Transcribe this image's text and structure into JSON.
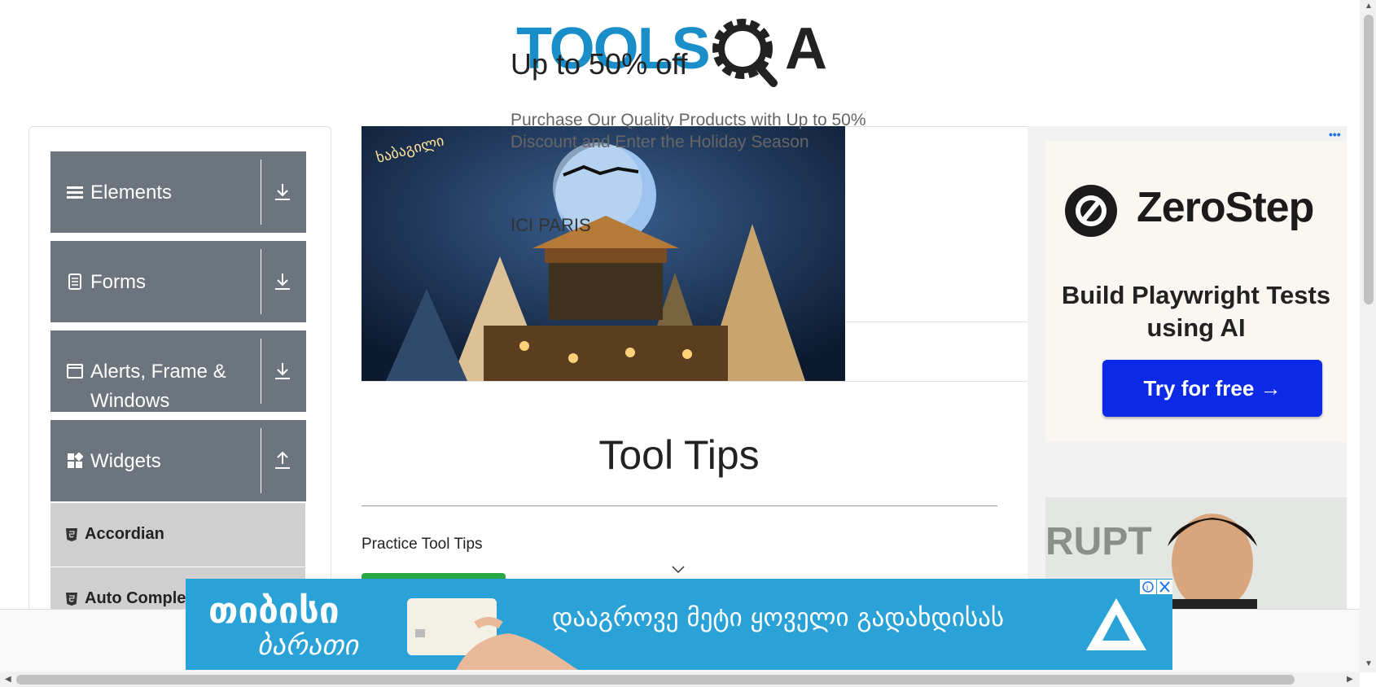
{
  "logo": {
    "text_left": "TOOLS",
    "text_right": "A",
    "brand_color": "#1a8ec9"
  },
  "sidebar": {
    "groups": [
      {
        "label": "Elements",
        "icon": "hamburger-icon",
        "arrow": "download-arrow-icon"
      },
      {
        "label": "Forms",
        "icon": "document-icon",
        "arrow": "download-arrow-icon"
      },
      {
        "label": "Alerts, Frame & Windows",
        "icon": "window-icon",
        "arrow": "download-arrow-icon"
      },
      {
        "label": "Widgets",
        "icon": "widgets-icon",
        "arrow": "upload-arrow-icon"
      }
    ],
    "items": [
      {
        "label": "Accordian"
      },
      {
        "label": "Auto Complete"
      }
    ]
  },
  "banner_ad": {
    "headline": "Up to 50% off",
    "sub": "Purchase Our Quality Products with Up to 50%\nDiscount and Enter the Holiday Season",
    "brand": "ICI PARIS",
    "overlay_text": "ხაბაგილი"
  },
  "side_ad": {
    "brand": "ZeroStep",
    "tagline": "Build Playwright Tests using AI",
    "cta": "Try for free →",
    "cta_color": "#0b29e6",
    "photo_text": "RUPT"
  },
  "main": {
    "title": "Tool Tips",
    "practice_label": "Practice Tool Tips"
  },
  "bottom_ad": {
    "brand_line1": "თიბისი",
    "brand_line2": "ბარათი",
    "text": "დააგროვე მეტი ყოველი გადახდისას",
    "bg_color": "#2aa2d8"
  }
}
